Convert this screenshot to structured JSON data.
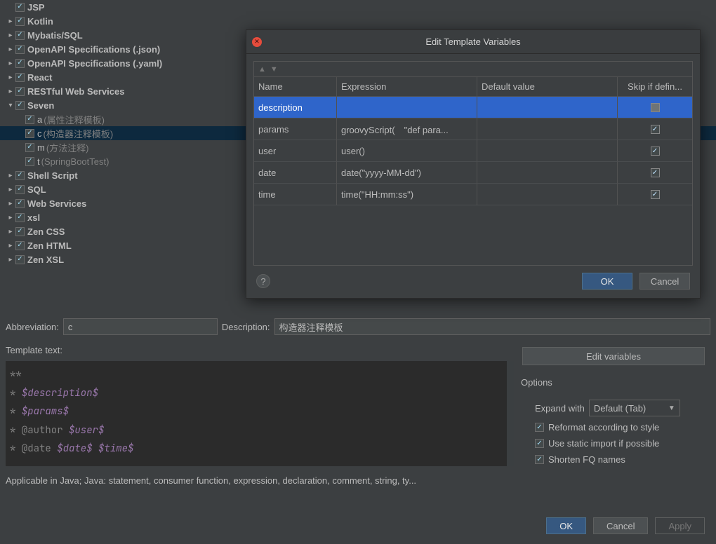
{
  "tree": {
    "jsp": "JSP",
    "kotlin": "Kotlin",
    "mybatis": "Mybatis/SQL",
    "openapi_json": "OpenAPI Specifications (.json)",
    "openapi_yaml": "OpenAPI Specifications (.yaml)",
    "react": "React",
    "restful": "RESTful Web Services",
    "seven": "Seven",
    "seven_children": {
      "a": "a",
      "a_hint": "(属性注释模板)",
      "c": "c",
      "c_hint": "(构造器注释模板)",
      "m": "m",
      "m_hint": "(方法注释)",
      "t": "t",
      "t_hint": "(SpringBootTest)"
    },
    "shellscript": "Shell Script",
    "sql": "SQL",
    "webservices": "Web Services",
    "xsl": "xsl",
    "zencss": "Zen CSS",
    "zenhtml": "Zen HTML",
    "zenxsl": "Zen XSL"
  },
  "form": {
    "abbrev_label": "Abbreviation:",
    "abbrev_value": "c",
    "desc_label": "Description:",
    "desc_value": "构造器注释模板",
    "template_label": "Template text:",
    "applicable": "Applicable in Java; Java: statement, consumer function, expression, declaration, comment, string, ty..."
  },
  "template_code": {
    "l1": "**",
    "l2_a": " * ",
    "l2_b": "$description$",
    "l3_a": " * ",
    "l3_b": "$params$",
    "l4_a": " * @author ",
    "l4_b": "$user$",
    "l5_a": " * @date ",
    "l5_b": "$date$",
    "l5_c": " ",
    "l5_d": "$time$"
  },
  "right": {
    "edit_vars": "Edit variables",
    "options": "Options",
    "expand_with": "Expand with",
    "expand_value": "Default (Tab)",
    "reformat": "Reformat according to style",
    "static_import": "Use static import if possible",
    "shorten_fq": "Shorten FQ names"
  },
  "bottom": {
    "ok": "OK",
    "cancel": "Cancel",
    "apply": "Apply"
  },
  "modal": {
    "title": "Edit Template Variables",
    "cols": {
      "name": "Name",
      "expr": "Expression",
      "def": "Default value",
      "skip": "Skip if defin..."
    },
    "rows": [
      {
        "name": "description",
        "expr": "",
        "def": "",
        "skip": false,
        "selected": true
      },
      {
        "name": "params",
        "expr": "groovyScript(　\"def para...",
        "def": "",
        "skip": true
      },
      {
        "name": "user",
        "expr": "user()",
        "def": "",
        "skip": true
      },
      {
        "name": "date",
        "expr": "date(\"yyyy-MM-dd\")",
        "def": "",
        "skip": true
      },
      {
        "name": "time",
        "expr": "time(\"HH:mm:ss\")",
        "def": "",
        "skip": true
      }
    ],
    "ok": "OK",
    "cancel": "Cancel",
    "help": "?"
  }
}
